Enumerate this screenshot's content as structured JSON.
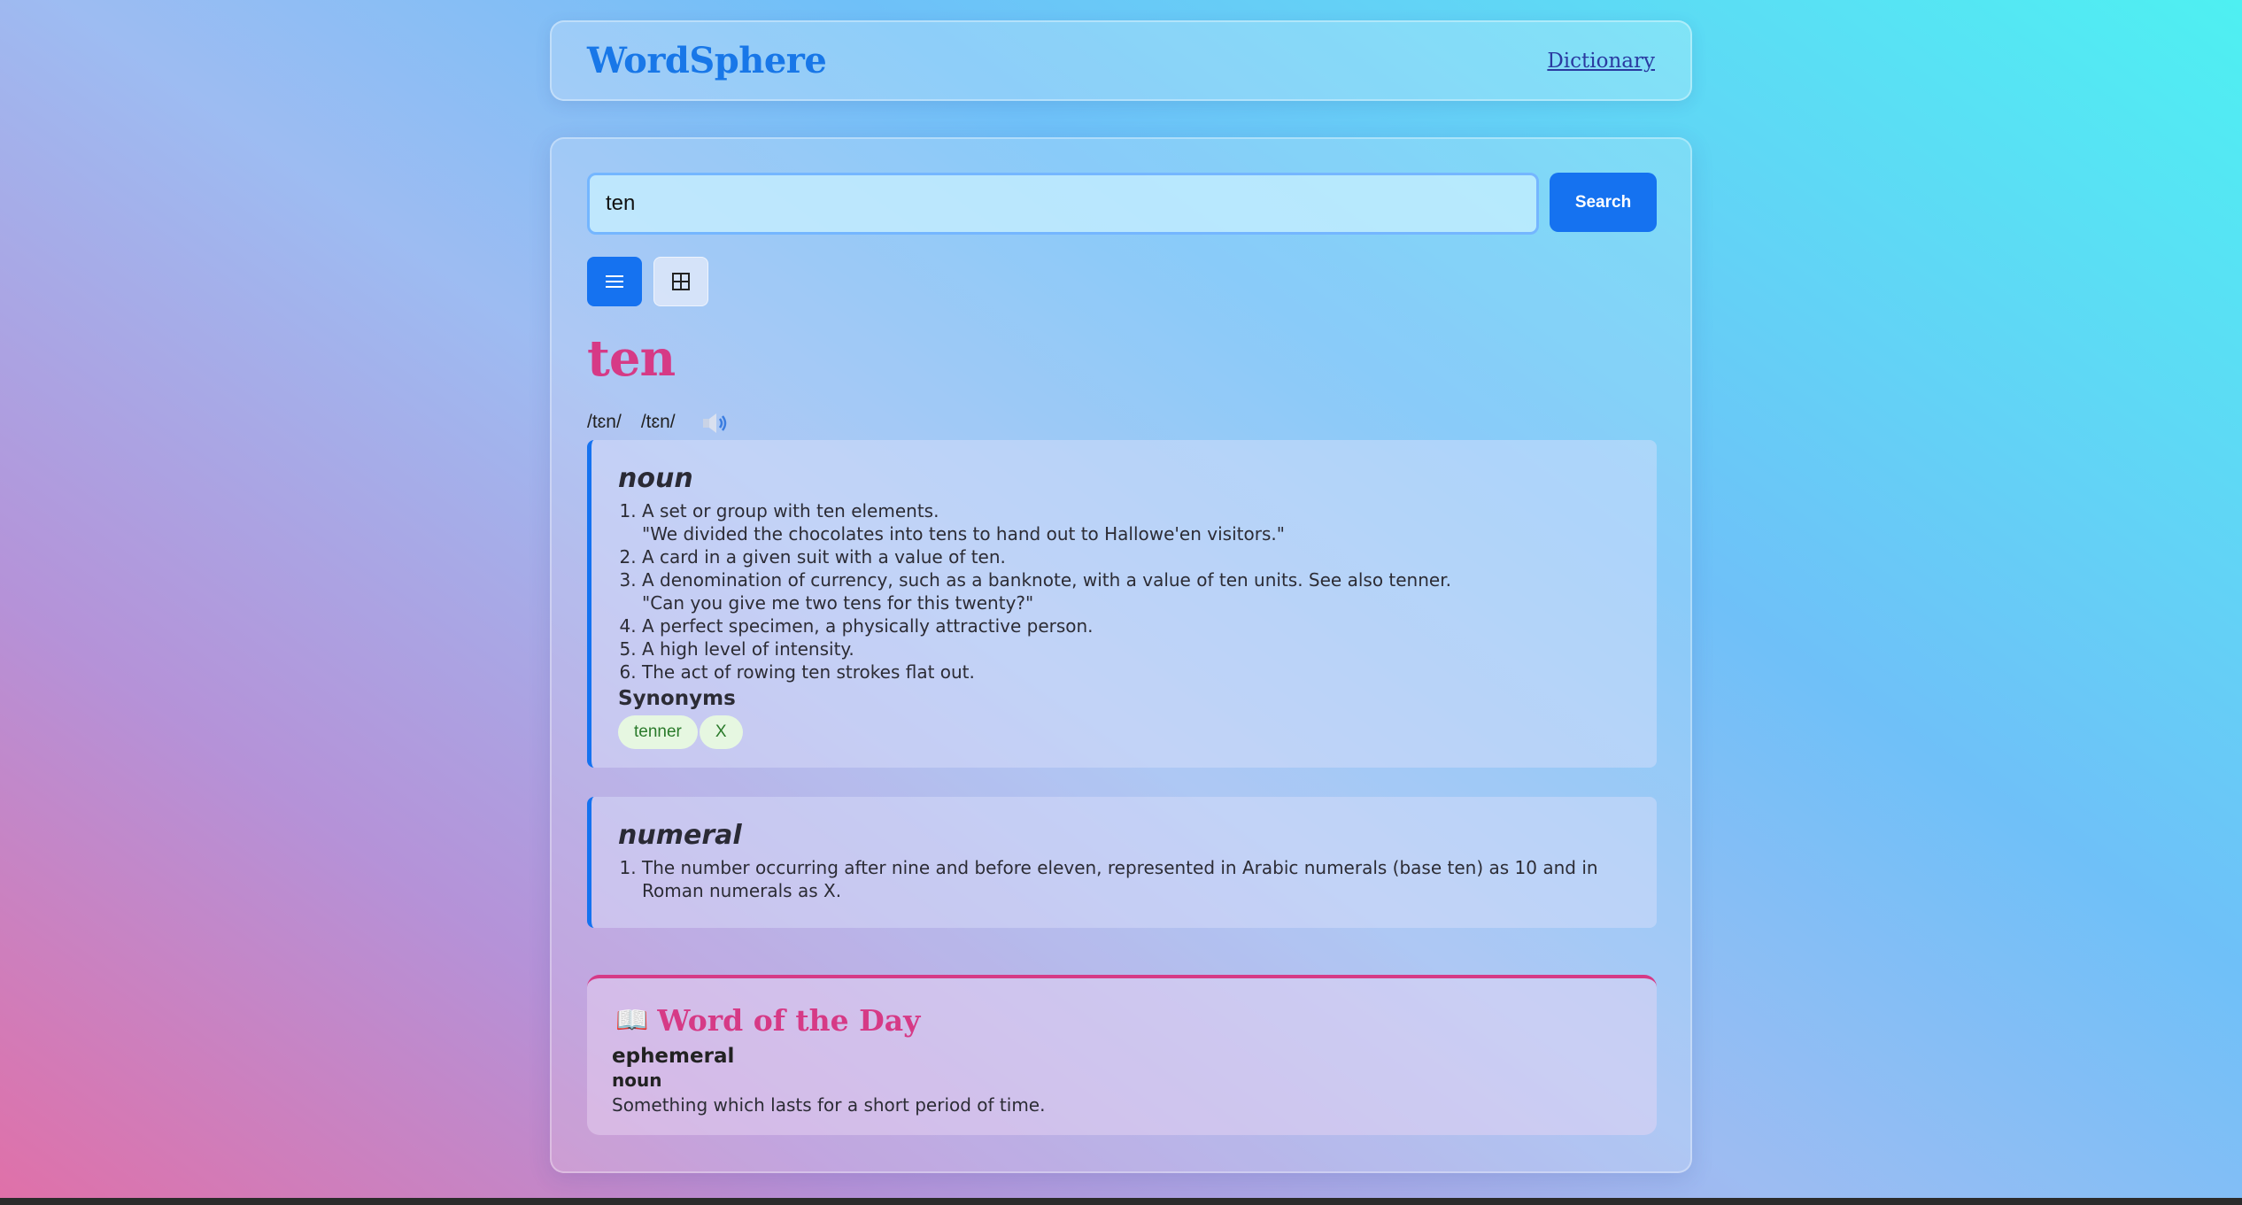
{
  "header": {
    "logo": "WordSphere",
    "nav_link": "Dictionary"
  },
  "search": {
    "value": "ten",
    "button_label": "Search"
  },
  "view_toggle": {
    "list_icon": "list-icon",
    "grid_icon": "grid-icon",
    "active": "list"
  },
  "entry": {
    "word": "ten",
    "phonetics": [
      "/tɛn/",
      "/tɛn/"
    ],
    "audio_icon": "speaker-icon",
    "meanings": [
      {
        "part_of_speech": "noun",
        "definitions": [
          {
            "text": "A set or group with ten elements.",
            "example": "\"We divided the chocolates into tens to hand out to Hallowe'en visitors.\""
          },
          {
            "text": "A card in a given suit with a value of ten.",
            "example": ""
          },
          {
            "text": "A denomination of currency, such as a banknote, with a value of ten units. See also tenner.",
            "example": "\"Can you give me two tens for this twenty?\""
          },
          {
            "text": "A perfect specimen, a physically attractive person.",
            "example": ""
          },
          {
            "text": "A high level of intensity.",
            "example": ""
          },
          {
            "text": "The act of rowing ten strokes flat out.",
            "example": ""
          }
        ],
        "synonyms_title": "Synonyms",
        "synonyms": [
          "tenner",
          "X"
        ]
      },
      {
        "part_of_speech": "numeral",
        "definitions": [
          {
            "text": "The number occurring after nine and before eleven, represented in Arabic numerals (base ten) as 10 and in Roman numerals as X.",
            "example": ""
          }
        ]
      }
    ]
  },
  "word_of_the_day": {
    "icon": "book-icon",
    "title": "Word of the Day",
    "word": "ephemeral",
    "part_of_speech": "noun",
    "definition": "Something which lasts for a short period of time."
  },
  "colors": {
    "accent": "#1572f0",
    "headword": "#d63a86",
    "chip_bg": "#e6f7e1",
    "chip_text": "#2a7a2a"
  }
}
